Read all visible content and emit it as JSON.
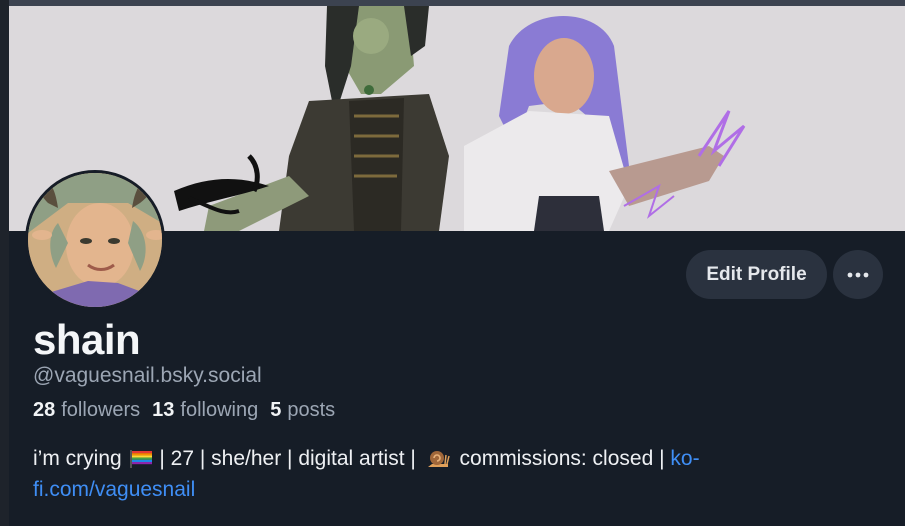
{
  "profile": {
    "display_name": "shain",
    "handle": "@vaguesnail.bsky.social",
    "stats": {
      "followers_count": "28",
      "followers_label": "followers",
      "following_count": "13",
      "following_label": "following",
      "posts_count": "5",
      "posts_label": "posts"
    },
    "bio": {
      "part1": "i’m crying",
      "part2": "| 27 | she/her | digital artist |",
      "part3": "commissions: closed |",
      "link": "ko-fi.com/vaguesnail"
    }
  },
  "actions": {
    "edit_profile_label": "Edit Profile"
  },
  "icons": {
    "more": "more-dots-icon",
    "flag": "rainbow-flag-icon",
    "snail": "snail-icon"
  },
  "colors": {
    "background": "#161d27",
    "button_bg": "#2a323f",
    "link": "#3f8ef5",
    "muted_text": "#9ca6b4"
  }
}
